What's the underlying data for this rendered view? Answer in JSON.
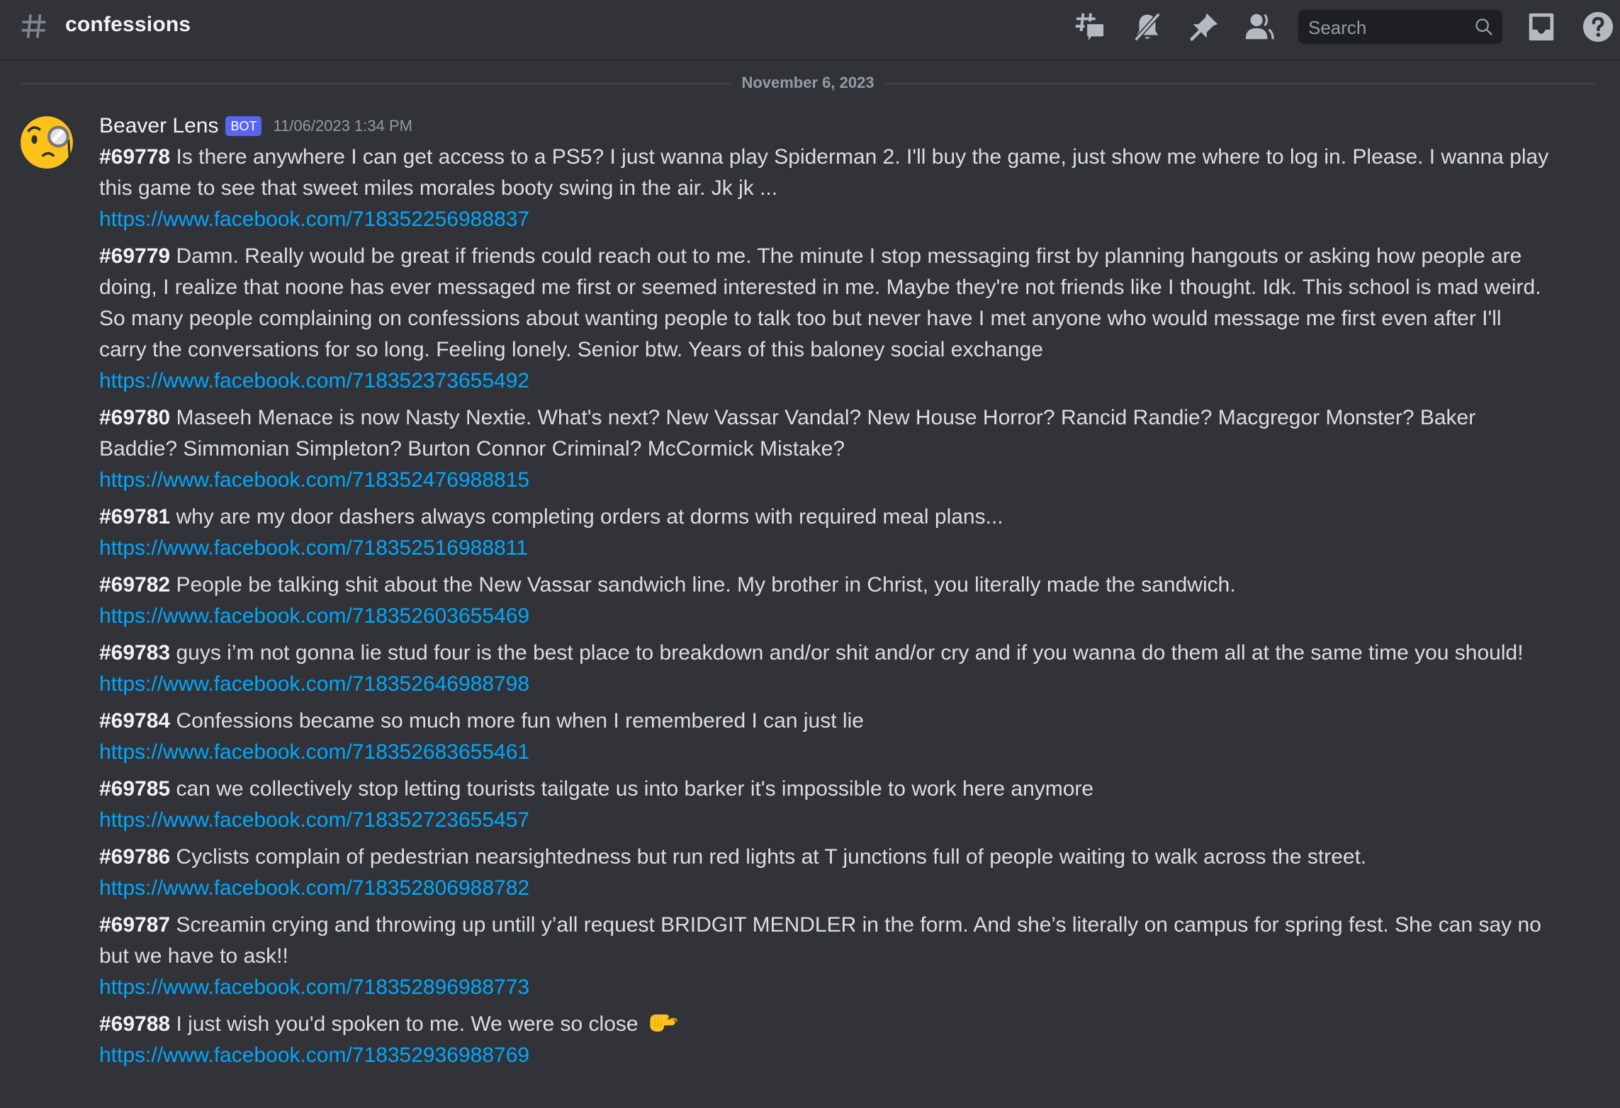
{
  "header": {
    "channel_icon": "hashtag-icon",
    "channel_name": "confessions",
    "icons": [
      "threads-icon",
      "notification-muted-icon",
      "pinned-messages-icon",
      "member-list-icon",
      "inbox-icon",
      "help-icon"
    ],
    "search_placeholder": "Search"
  },
  "date_divider": "November 6, 2023",
  "message": {
    "author": "Beaver Lens",
    "badge": "BOT",
    "timestamp": "11/06/2023 1:34 PM",
    "avatar_icon": "face-with-monocle-emoji",
    "confessions": [
      {
        "number": "#69778",
        "text": "Is there anywhere I can get access to a PS5? I just wanna play Spiderman 2. I'll buy the game, just show me where to log in. Please. I wanna play this game to see that sweet miles morales booty swing in the air. Jk jk ...",
        "link": "https://www.facebook.com/718352256988837"
      },
      {
        "number": "#69779",
        "text": "Damn. Really would be great if friends could reach out to me. The minute I stop messaging first by planning hangouts or asking how people are doing, I realize that noone has ever messaged me first or seemed interested in me. Maybe they're not friends like I thought. Idk. This school is mad weird. So many people complaining on confessions about wanting people to talk too but never have I met anyone who would message me first even after I'll carry the conversations for so long. Feeling lonely. Senior btw. Years of this baloney social exchange",
        "link": "https://www.facebook.com/718352373655492"
      },
      {
        "number": "#69780",
        "text": "Maseeh Menace is now Nasty Nextie. What's next? New Vassar Vandal? New House Horror? Rancid Randie? Macgregor Monster? Baker Baddie? Simmonian Simpleton? Burton Connor Criminal? McCormick Mistake?",
        "link": "https://www.facebook.com/718352476988815"
      },
      {
        "number": "#69781",
        "text": "why are my door dashers always completing orders at dorms with required meal plans...",
        "link": "https://www.facebook.com/718352516988811"
      },
      {
        "number": "#69782",
        "text": "People be talking shit about the New Vassar sandwich line. My brother in Christ, you literally made the sandwich.",
        "link": "https://www.facebook.com/718352603655469"
      },
      {
        "number": "#69783",
        "text": "guys i’m not gonna lie stud four is the best place to breakdown and/or shit and/or cry and if you wanna do them all at the same time you should!",
        "link": "https://www.facebook.com/718352646988798"
      },
      {
        "number": "#69784",
        "text": "Confessions became so much more fun when I remembered I can just lie",
        "link": "https://www.facebook.com/718352683655461"
      },
      {
        "number": "#69785",
        "text": "can we collectively stop letting tourists tailgate us into barker it's impossible to work here anymore",
        "link": "https://www.facebook.com/718352723655457"
      },
      {
        "number": "#69786",
        "text": "Cyclists complain of pedestrian nearsightedness but run red lights at T junctions full of people waiting to walk across the street.",
        "link": "https://www.facebook.com/718352806988782"
      },
      {
        "number": "#69787",
        "text": "Screamin crying and throwing up untill y’all request BRIDGIT MENDLER in the form. And she’s literally on campus for spring fest. She can say no but we have to ask!!",
        "link": "https://www.facebook.com/718352896988773"
      },
      {
        "number": "#69788",
        "text": "I just wish you'd spoken to me. We were so close",
        "emoji": "pinching-hand-emoji",
        "link": "https://www.facebook.com/718352936988769"
      }
    ]
  }
}
